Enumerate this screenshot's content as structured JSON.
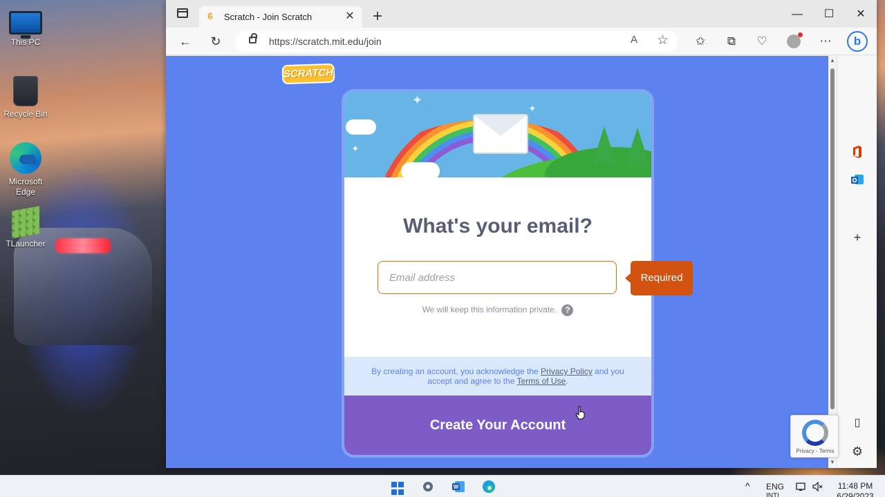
{
  "desktop": {
    "icons": [
      {
        "label": "This PC"
      },
      {
        "label": "Recycle Bin"
      },
      {
        "label": "Microsoft Edge"
      },
      {
        "label": "TLauncher"
      }
    ]
  },
  "browser": {
    "tab": {
      "title": "Scratch - Join Scratch",
      "close": "✕"
    },
    "new_tab": "+",
    "window_controls": {
      "minimize": "—",
      "maximize": "☐",
      "close": "✕"
    },
    "toolbar": {
      "back": "←",
      "refresh": "↻",
      "read_aloud": "A",
      "favorite": "☆",
      "favorites": "✩",
      "collections": "⧉",
      "health": "♡",
      "more": "⋯",
      "bing": "b"
    },
    "url": "https://scratch.mit.edu/join"
  },
  "page": {
    "logo_text": "SCRATCH",
    "heading": "What's your email?",
    "email": {
      "placeholder": "Email address",
      "value": ""
    },
    "private_note": "We will keep this information private.",
    "help_glyph": "?",
    "required_label": "Required",
    "legal": {
      "prefix": "By creating an account, you acknowledge the ",
      "privacy_link": "Privacy Policy",
      "middle": " and you accept and agree to the ",
      "terms_link": "Terms of Use",
      "suffix": "."
    },
    "create_button": "Create Your Account"
  },
  "recaptcha": {
    "footer": "Privacy - Terms"
  },
  "sidebar": {
    "add": "+",
    "settings": "⚙",
    "panel": "▯"
  },
  "taskbar": {
    "tray_chevron": "^",
    "language": "ENG",
    "language_sub": "INTL",
    "time": "11:48 PM",
    "date": "6/29/2023"
  },
  "colors": {
    "page_bg": "#5c82f0",
    "create_button": "#7d5cc7",
    "required_tag": "#d2520f",
    "heading_text": "#575e75",
    "legal_bg": "#d9e8fb"
  },
  "icons": [
    "this-pc-icon",
    "recycle-bin-icon",
    "edge-icon",
    "tlauncher-icon",
    "scratch-favicon",
    "lock-icon",
    "star-icon",
    "help-icon",
    "office-icon",
    "outlook-icon",
    "recaptcha-icon",
    "windows-start-icon",
    "settings-icon",
    "word-icon"
  ]
}
